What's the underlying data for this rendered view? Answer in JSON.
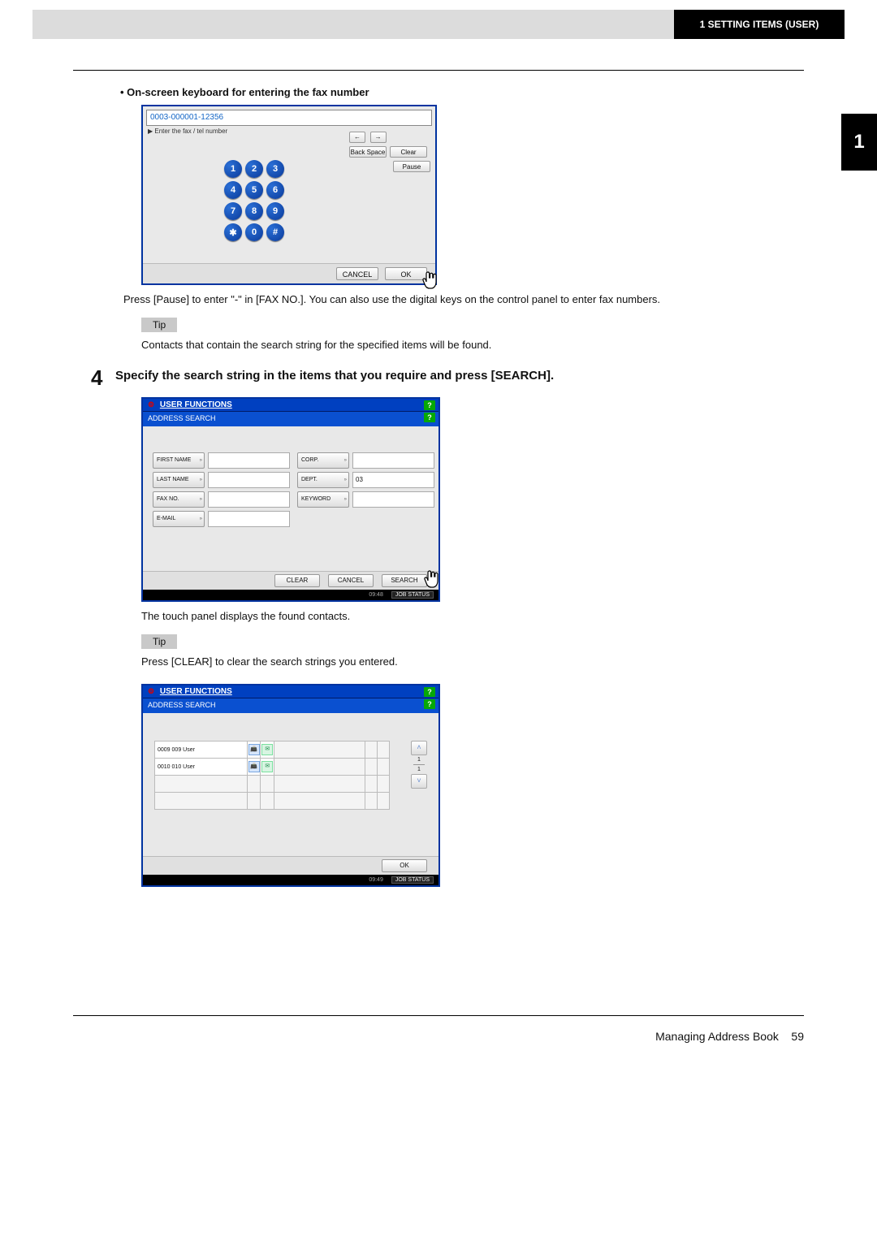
{
  "header": {
    "chapter": "1 SETTING ITEMS (USER)"
  },
  "side_tab": "1",
  "section1": {
    "bullet": "•  On-screen keyboard for entering the fax number",
    "keypad": {
      "display_value": "0003-000001-12356",
      "instruction": "Enter the fax / tel number",
      "arrows": {
        "left": "←",
        "right": "→"
      },
      "backspace": "Back Space",
      "clear": "Clear",
      "pause": "Pause",
      "keys": [
        "1",
        "2",
        "3",
        "4",
        "5",
        "6",
        "7",
        "8",
        "9",
        "✱",
        "0",
        "#"
      ],
      "cancel": "CANCEL",
      "ok": "OK"
    },
    "note": "Press [Pause] to enter \"-\" in [FAX NO.]. You can also use the digital keys on the control panel to enter fax numbers.",
    "tip_label": "Tip",
    "tip_text": "Contacts that contain the search string for the specified items will be found."
  },
  "step4": {
    "num": "4",
    "heading": "Specify the search string in the items that you require and press [SEARCH].",
    "panel": {
      "title_icon": "⚙",
      "title": "USER FUNCTIONS",
      "tab": "ADDRESS SEARCH",
      "help": "?",
      "left_fields": [
        "FIRST NAME",
        "LAST NAME",
        "FAX NO.",
        "E-MAIL"
      ],
      "right_fields": [
        "CORP.",
        "DEPT.",
        "KEYWORD"
      ],
      "dept_value": "03",
      "buttons": {
        "clear": "CLEAR",
        "cancel": "CANCEL",
        "search": "SEARCH"
      },
      "time": "09:48",
      "job": "JOB STATUS"
    },
    "after1": "The touch panel displays the found contacts.",
    "tip_label": "Tip",
    "tip_text": "Press [CLEAR] to clear the search strings you entered.",
    "results": {
      "title_icon": "⚙",
      "title": "USER FUNCTIONS",
      "tab": "ADDRESS SEARCH",
      "help": "?",
      "rows": [
        {
          "id": "0009",
          "name": "009 User"
        },
        {
          "id": "0010",
          "name": "010 User"
        }
      ],
      "page_current": "1",
      "page_total": "1",
      "ok": "OK",
      "time": "09:49",
      "job": "JOB STATUS"
    }
  },
  "footer": {
    "text": "Managing Address Book",
    "page": "59"
  }
}
